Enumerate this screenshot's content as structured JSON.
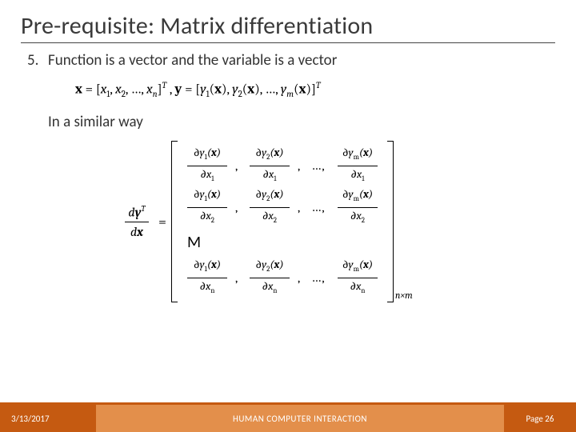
{
  "title": "Pre-requisite: Matrix differentiation",
  "item_number": "5.",
  "item_text": "Function is a vector and the variable is a vector",
  "similar": "In a similar way",
  "eq1": {
    "x_label": "x",
    "y_label": "y",
    "x_elems": [
      "x₁",
      "x₂",
      "…",
      "xₙ"
    ],
    "y_elems": [
      "y₁(x)",
      "y₂(x)",
      "…",
      "yₘ(x)"
    ]
  },
  "lhs": {
    "top": "dyᵀ",
    "bot": "dx"
  },
  "matrix": {
    "rows": [
      {
        "denom_sub": "1",
        "numers": [
          "1",
          "2",
          "m"
        ]
      },
      {
        "denom_sub": "2",
        "numers": [
          "1",
          "2",
          "m"
        ]
      },
      {
        "M": "M"
      },
      {
        "denom_sub": "n",
        "numers": [
          "1",
          "2",
          "m"
        ]
      }
    ],
    "size_sub": "n×m"
  },
  "footer": {
    "date": "3/13/2017",
    "center": "HUMAN COMPUTER INTERACTION",
    "page": "Page 26"
  }
}
